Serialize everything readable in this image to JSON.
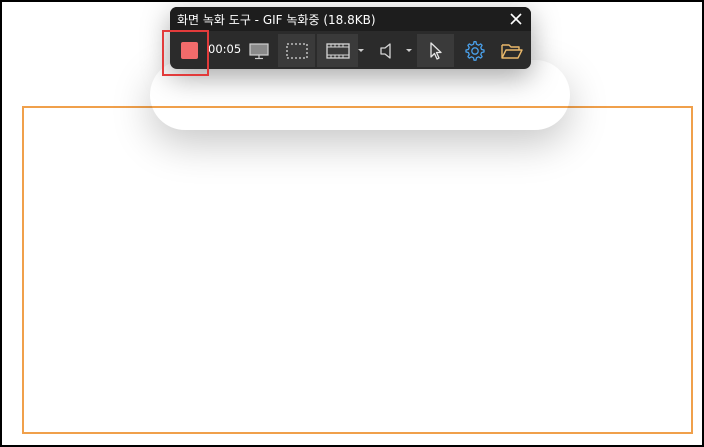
{
  "recorder": {
    "title": "화면 녹화 도구 - GIF 녹화중 (18.8KB)",
    "timer": "00:05"
  },
  "toolbar": {
    "buttons": [
      {
        "name": "stop-record-button",
        "icon": "stop-square-icon"
      },
      {
        "name": "fullscreen-capture-button",
        "icon": "monitor-icon"
      },
      {
        "name": "region-capture-button",
        "icon": "dashed-rectangle-icon"
      },
      {
        "name": "format-button",
        "icon": "film-strip-icon"
      },
      {
        "name": "audio-button",
        "icon": "speaker-icon"
      },
      {
        "name": "cursor-button",
        "icon": "cursor-arrow-icon"
      },
      {
        "name": "settings-button",
        "icon": "gear-icon"
      },
      {
        "name": "open-folder-button",
        "icon": "folder-open-icon"
      }
    ]
  },
  "colors": {
    "recorder_bg": "#2b2b2b",
    "title_bar_bg": "#1d1d1d",
    "stop_button": "#f26b6b",
    "capture_area_border": "#f0a04b",
    "settings_icon": "#4a9fe8",
    "folder_icon": "#e9b86a",
    "highlight_box": "#e23b3b"
  }
}
